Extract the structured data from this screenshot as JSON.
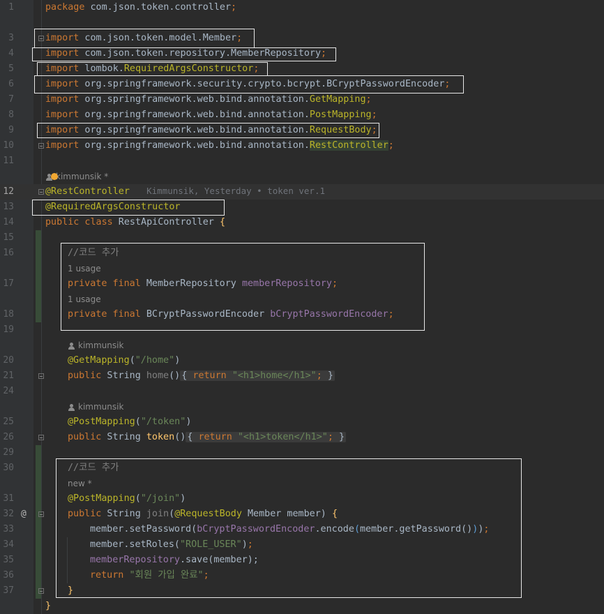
{
  "editor": {
    "author": "kimmunsik",
    "author_star": "kimmunsik *",
    "blame_text": "Kimmunsik, Yesterday • token ver.1",
    "usage_hint": "1 usage",
    "new_hint": "new *",
    "gutter_at": "@",
    "line_numbers": [
      "1",
      "3",
      "4",
      "5",
      "6",
      "7",
      "8",
      "9",
      "10",
      "11",
      "12",
      "13",
      "14",
      "15",
      "16",
      "17",
      "18",
      "19",
      "20",
      "21",
      "24",
      "25",
      "26",
      "29",
      "30",
      "31",
      "32",
      "33",
      "34",
      "35",
      "36",
      "37"
    ],
    "lines": {
      "l1_package": "package",
      "l1_name": " com.json.token.controller",
      "import_kw": "import",
      "l3_path": " com.json.token.model.Member",
      "l4_path": " com.json.token.repository.MemberRepository",
      "l5_path": " lombok.",
      "l5_cls": "RequiredArgsConstructor",
      "l6_path": " org.springframework.security.crypto.bcrypt.BCryptPasswordEncoder",
      "l7_path": " org.springframework.web.bind.annotation.",
      "l7_cls": "GetMapping",
      "l8_cls": "PostMapping",
      "l9_cls": "RequestBody",
      "l10_cls": "RestController",
      "semicolon": ";",
      "ann_rest": "@RestController",
      "ann_req": "@RequiredArgsConstructor",
      "l14_public": "public",
      "l14_class": " class",
      "l14_name": " RestApiController ",
      "l14_brace": "{",
      "comment_code_add": "//코드 추가",
      "private_final": "private final",
      "l17_type": " MemberRepository ",
      "l17_field": "memberRepository",
      "l18_type": " BCryptPasswordEncoder ",
      "l18_field": "bCryptPasswordEncoder",
      "l20_ann": "@GetMapping",
      "l20_arg": "\"/home\"",
      "public_kw": "public",
      "string_type": " String ",
      "l21_method": "home",
      "parens": "()",
      "return_kw": "return",
      "l21_str": "\"<h1>home</h1>\"",
      "l25_ann": "@PostMapping",
      "l25_arg": "\"/token\"",
      "l26_method": "token",
      "l26_str": "\"<h1>token</h1>\"",
      "l31_ann": "@PostMapping",
      "l31_arg": "\"/join\"",
      "l32_method": "join",
      "l32_param_ann": "@RequestBody",
      "l32_params": " Member member) ",
      "l33_a": "member.setPassword(",
      "l33_field": "bCryptPasswordEncoder",
      "l33_b": ".encode",
      "l33_c": "member.getPassword()",
      "l34_a": "member.setRoles(",
      "l34_str": "\"ROLE_USER\"",
      "l35_field": "memberRepository",
      "l35_b": ".save(member);",
      "l36_str": "\"회원 가입 완료\"",
      "close_brace": "}"
    }
  }
}
